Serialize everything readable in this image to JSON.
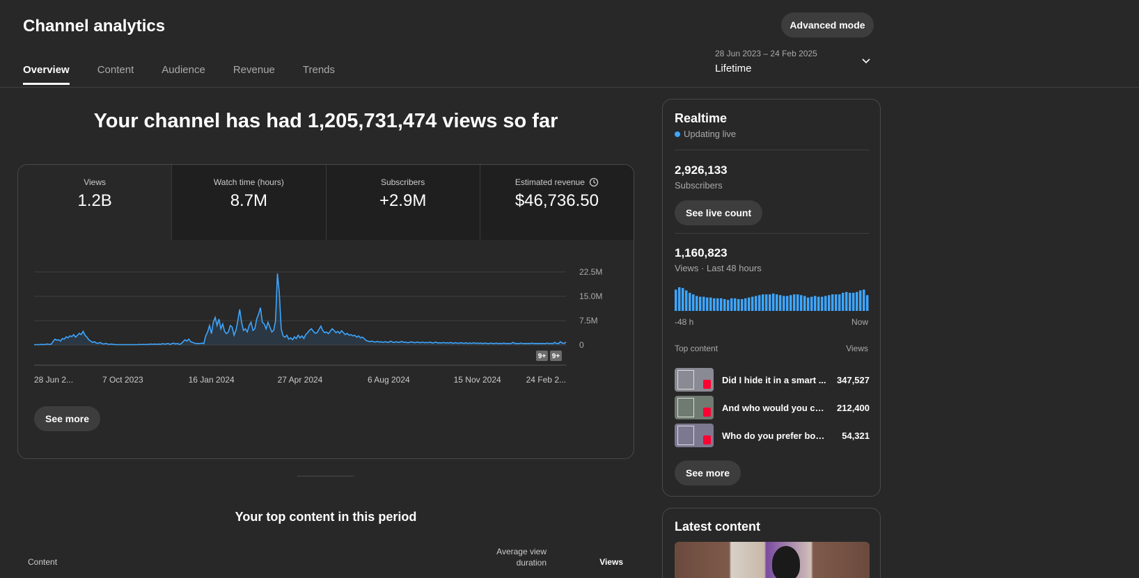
{
  "header": {
    "title": "Channel analytics",
    "advanced_mode": "Advanced mode",
    "tabs": [
      {
        "label": "Overview"
      },
      {
        "label": "Content"
      },
      {
        "label": "Audience"
      },
      {
        "label": "Revenue"
      },
      {
        "label": "Trends"
      }
    ],
    "date_range": {
      "dates": "28 Jun 2023 – 24 Feb 2025",
      "label": "Lifetime"
    }
  },
  "main": {
    "headline": "Your channel has had 1,205,731,474 views so far",
    "metrics": [
      {
        "label": "Views",
        "value": "1.2B"
      },
      {
        "label": "Watch time (hours)",
        "value": "8.7M"
      },
      {
        "label": "Subscribers",
        "value": "+2.9M"
      },
      {
        "label": "Estimated revenue",
        "value": "$46,736.50"
      }
    ],
    "see_more": "See more",
    "markers": [
      "9+",
      "9+"
    ],
    "top_content_title": "Your top content in this period",
    "table_headers": {
      "content": "Content",
      "avg_view_duration": "Average view duration",
      "views": "Views"
    }
  },
  "realtime": {
    "title": "Realtime",
    "status": "Updating live",
    "subscribers_value": "2,926,133",
    "subscribers_label": "Subscribers",
    "see_live_count": "See live count",
    "views_value": "1,160,823",
    "views_label": "Views · Last 48 hours",
    "axis_start": "-48 h",
    "axis_end": "Now",
    "top_content_label": "Top content",
    "views_col": "Views",
    "items": [
      {
        "title": "Did I hide it in a smart ...",
        "views": "347,527"
      },
      {
        "title": "And who would you ch...",
        "views": "212,400"
      },
      {
        "title": "Who do you prefer boys ...",
        "views": "54,321"
      }
    ],
    "see_more": "See more",
    "hourly_bars": [
      27,
      30,
      29,
      26,
      23,
      21,
      19,
      18,
      18,
      17,
      17,
      16,
      16,
      16,
      15,
      14,
      16,
      16,
      15,
      15,
      16,
      17,
      18,
      19,
      20,
      21,
      21,
      21,
      22,
      21,
      20,
      19,
      19,
      20,
      21,
      21,
      20,
      19,
      17,
      18,
      19,
      18,
      18,
      19,
      20,
      21,
      21,
      21,
      23,
      24,
      23,
      23,
      24,
      26,
      27,
      20
    ]
  },
  "latest": {
    "title": "Latest content"
  },
  "colors": {
    "accent": "#3ea6ff",
    "background": "#282828",
    "card": "#1f1f1f",
    "shorts_red": "#ff0033"
  },
  "chart_data": {
    "type": "area",
    "title": "",
    "xlabel": "",
    "ylabel": "",
    "ylim": [
      0,
      22.5
    ],
    "y_unit": "M",
    "yticks": [
      0,
      7.5,
      15.0,
      22.5
    ],
    "ytick_labels": [
      "0",
      "7.5M",
      "15.0M",
      "22.5M"
    ],
    "xtick_labels": [
      "28 Jun 2...",
      "7 Oct 2023",
      "16 Jan 2024",
      "27 Apr 2024",
      "6 Aug 2024",
      "15 Nov 2024",
      "24 Feb 2..."
    ],
    "grid": true,
    "series": [
      {
        "values": [
          0.1,
          0.1,
          0.1,
          0.1,
          0.2,
          0.1,
          0.2,
          0.3,
          0.2,
          0.2,
          1.0,
          1.8,
          1.5,
          1.6,
          1.2,
          2.0,
          1.8,
          2.5,
          2.2,
          2.8,
          2.6,
          3.2,
          2.4,
          3.0,
          3.6,
          3.2,
          4.2,
          3.0,
          2.4,
          1.6,
          1.2,
          0.8,
          1.0,
          0.6,
          0.5,
          0.8,
          0.4,
          0.3,
          0.5,
          0.3,
          0.2,
          0.3,
          0.2,
          0.1,
          0.1,
          0.1,
          0.1,
          0.1,
          0.1,
          0.1,
          0.1,
          0.1,
          0.1,
          0.1,
          0.1,
          0.1,
          0.2,
          0.1,
          0.2,
          0.1,
          0.2,
          0.2,
          0.3,
          0.2,
          0.3,
          0.2,
          0.3,
          0.2,
          0.4,
          0.3,
          0.3,
          0.5,
          0.2,
          0.4,
          0.6,
          0.3,
          0.5,
          0.2,
          0.4,
          1.0,
          1.6,
          1.2,
          1.8,
          1.0,
          0.8,
          0.6,
          0.4,
          0.5,
          0.4,
          0.6,
          0.4,
          2.8,
          4.0,
          6.0,
          3.5,
          7.0,
          8.5,
          6.0,
          8.0,
          5.0,
          6.5,
          4.2,
          3.5,
          4.0,
          6.0,
          5.5,
          3.0,
          4.5,
          7.5,
          11.0,
          7.0,
          4.5,
          5.0,
          4.0,
          6.0,
          7.0,
          4.5,
          5.0,
          8.0,
          9.5,
          11.5,
          7.0,
          6.5,
          5.0,
          7.0,
          5.5,
          4.0,
          4.5,
          7.5,
          22.0,
          16.0,
          5.0,
          2.8,
          2.4,
          3.0,
          1.8,
          2.2,
          1.6,
          2.5,
          2.0,
          3.0,
          2.2,
          2.8,
          2.0,
          3.2,
          3.8,
          4.5,
          5.0,
          4.2,
          3.6,
          3.8,
          4.8,
          5.8,
          4.5,
          3.8,
          4.0,
          3.5,
          4.2,
          5.0,
          4.5,
          3.8,
          4.2,
          3.6,
          4.4,
          3.8,
          3.2,
          3.6,
          3.0,
          3.2,
          2.8,
          3.0,
          2.4,
          2.8,
          2.2,
          2.4,
          2.0,
          1.4,
          1.2,
          1.0,
          1.2,
          1.0,
          0.9,
          1.1,
          0.9,
          1.0,
          0.8,
          1.0,
          0.9,
          0.8,
          1.2,
          0.9,
          0.8,
          1.0,
          0.8,
          0.9,
          1.1,
          0.8,
          0.9,
          0.7,
          0.8,
          1.0,
          0.8,
          0.7,
          0.9,
          0.8,
          0.7,
          0.9,
          0.7,
          0.8,
          0.7,
          0.9,
          0.6,
          0.7,
          0.9,
          0.6,
          0.7,
          0.6,
          0.8,
          0.6,
          0.7,
          0.6,
          0.8,
          0.5,
          0.7,
          0.6,
          0.5,
          0.7,
          0.6,
          0.5,
          0.7,
          0.5,
          0.6,
          0.5,
          0.7,
          0.5,
          0.6,
          0.5,
          0.6,
          0.4,
          0.6,
          0.5,
          0.4,
          0.6,
          0.5,
          0.4,
          0.6,
          0.4,
          0.5,
          0.4,
          0.6,
          0.4,
          0.5,
          0.4,
          0.5,
          0.8,
          0.4,
          0.5,
          0.4,
          0.6,
          0.4,
          0.5,
          0.4,
          0.5,
          0.4,
          0.6,
          0.4,
          0.5,
          0.4,
          0.5,
          0.4,
          0.5,
          0.4,
          0.6,
          0.4,
          0.5,
          0.4,
          0.8,
          0.5,
          0.4,
          1.0,
          0.6,
          0.5,
          0.9
        ]
      }
    ]
  }
}
